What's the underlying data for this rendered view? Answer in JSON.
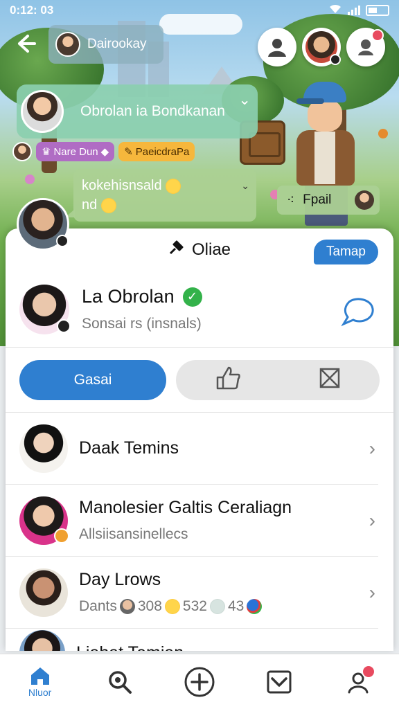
{
  "status_bar": {
    "time": "0:12: 03"
  },
  "header": {
    "username": "Dairookay"
  },
  "chat": {
    "big_bubble": "Obrolan ia Bondkanan",
    "tags": [
      "Nare Dun",
      "PaeicdraPa"
    ],
    "mid_bubble_line1": "kokehisnsald",
    "mid_bubble_line2": "nd",
    "small_bubble": "Fpail"
  },
  "sheet": {
    "title": "Oliae",
    "tamap_label": "Tamap",
    "profile": {
      "name": "La Obrolan",
      "subtitle": "Sonsai rs (insnals)"
    },
    "actions": {
      "primary_label": "Gasai"
    },
    "list": [
      {
        "title": "Daak Temins",
        "subtitle": ""
      },
      {
        "title": "Manolesier Galtis Ceraliagn",
        "subtitle": "Allsiisansinellecs"
      },
      {
        "title": "Day Lrows",
        "subtitle": "Dants",
        "reactions": [
          "308",
          "532",
          "43"
        ]
      },
      {
        "title": "Liahat Temian",
        "subtitle": ""
      }
    ]
  },
  "bottom_nav": {
    "home_label": "Nluor"
  },
  "colors": {
    "accent": "#2f7fd0",
    "verified": "#33b24a",
    "notify": "#e84a5f"
  }
}
